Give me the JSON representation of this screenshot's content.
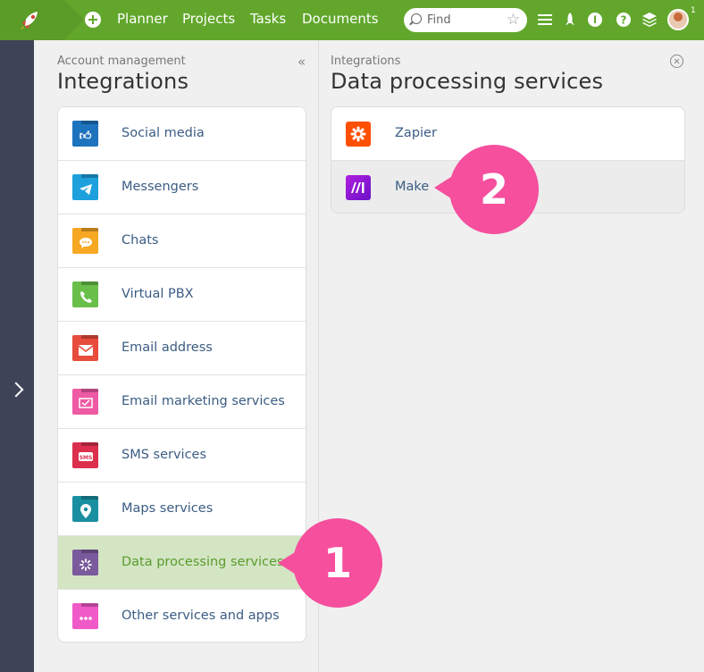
{
  "topbar": {
    "nav": [
      "Planner",
      "Projects",
      "Tasks",
      "Documents"
    ],
    "search_placeholder": "Find",
    "badge_count": "1",
    "colors": {
      "bar": "#62a72c",
      "logo_bg": "#5a9c27"
    }
  },
  "left_panel": {
    "breadcrumb": "Account management",
    "title": "Integrations",
    "items": [
      {
        "label": "Social media",
        "icon": "thumbs-up-icon",
        "color": "#1e73be"
      },
      {
        "label": "Messengers",
        "icon": "telegram-icon",
        "color": "#1ea0dc"
      },
      {
        "label": "Chats",
        "icon": "chat-bubble-icon",
        "color": "#f7a823"
      },
      {
        "label": "Virtual PBX",
        "icon": "phone-icon",
        "color": "#6abf4b"
      },
      {
        "label": "Email address",
        "icon": "envelope-icon",
        "color": "#e74c3c"
      },
      {
        "label": "Email marketing services",
        "icon": "newsletter-icon",
        "color": "#ee5aa4"
      },
      {
        "label": "SMS services",
        "icon": "sms-icon",
        "color": "#dc2f4d"
      },
      {
        "label": "Maps services",
        "icon": "map-pin-icon",
        "color": "#1a8fa0"
      },
      {
        "label": "Data processing services",
        "icon": "spinner-icon",
        "color": "#7a5a9c",
        "selected": true
      },
      {
        "label": "Other services and apps",
        "icon": "ellipsis-icon",
        "color": "#f05ac8"
      }
    ]
  },
  "right_panel": {
    "breadcrumb": "Integrations",
    "title": "Data processing services",
    "items": [
      {
        "label": "Zapier",
        "icon": "zapier-icon",
        "color": "#ff4f00"
      },
      {
        "label": "Make",
        "icon": "make-icon",
        "color": "#8c1ed8",
        "hover": true
      }
    ]
  },
  "callouts": [
    "1",
    "2"
  ],
  "callout_color": "#f54f9e"
}
